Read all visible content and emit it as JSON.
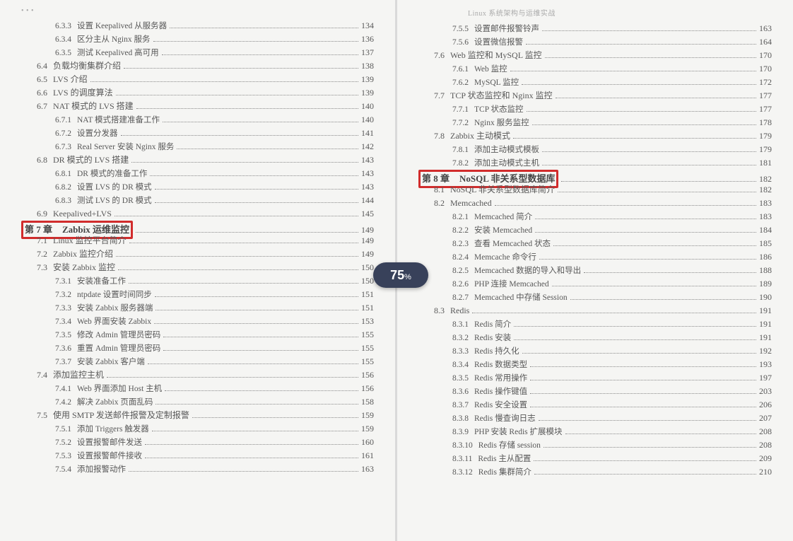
{
  "zoom": {
    "value": "75",
    "suffix": "%"
  },
  "left": {
    "header": "• • •",
    "lines": [
      {
        "lvl": 3,
        "num": "6.3.3",
        "text": "设置 Keepalived 从服务器",
        "page": "134"
      },
      {
        "lvl": 3,
        "num": "6.3.4",
        "text": "区分主从 Nginx 服务",
        "page": "136"
      },
      {
        "lvl": 3,
        "num": "6.3.5",
        "text": "测试 Keepalived 高可用",
        "page": "137"
      },
      {
        "lvl": 2,
        "num": "6.4",
        "text": "负载均衡集群介绍",
        "page": "138"
      },
      {
        "lvl": 2,
        "num": "6.5",
        "text": "LVS 介绍",
        "page": "139"
      },
      {
        "lvl": 2,
        "num": "6.6",
        "text": "LVS 的调度算法",
        "page": "139"
      },
      {
        "lvl": 2,
        "num": "6.7",
        "text": "NAT 模式的 LVS 搭建",
        "page": "140"
      },
      {
        "lvl": 3,
        "num": "6.7.1",
        "text": "NAT 模式搭建准备工作",
        "page": "140"
      },
      {
        "lvl": 3,
        "num": "6.7.2",
        "text": "设置分发器",
        "page": "141"
      },
      {
        "lvl": 3,
        "num": "6.7.3",
        "text": "Real Server 安装 Nginx 服务",
        "page": "142"
      },
      {
        "lvl": 2,
        "num": "6.8",
        "text": "DR 模式的 LVS 搭建",
        "page": "143"
      },
      {
        "lvl": 3,
        "num": "6.8.1",
        "text": "DR 模式的准备工作",
        "page": "143"
      },
      {
        "lvl": 3,
        "num": "6.8.2",
        "text": "设置 LVS 的 DR 模式",
        "page": "143"
      },
      {
        "lvl": 3,
        "num": "6.8.3",
        "text": "测试 LVS 的 DR 模式",
        "page": "144"
      },
      {
        "lvl": 2,
        "num": "6.9",
        "text": "Keepalived+LVS",
        "page": "145"
      },
      {
        "lvl": 1,
        "num": "第 7 章",
        "text": "Zabbix 运维监控",
        "page": "149",
        "hl": true
      },
      {
        "lvl": 2,
        "num": "7.1",
        "text": "Linux 监控平台简介",
        "page": "149"
      },
      {
        "lvl": 2,
        "num": "7.2",
        "text": "Zabbix 监控介绍",
        "page": "149"
      },
      {
        "lvl": 2,
        "num": "7.3",
        "text": "安装 Zabbix 监控",
        "page": "150"
      },
      {
        "lvl": 3,
        "num": "7.3.1",
        "text": "安装准备工作",
        "page": "150"
      },
      {
        "lvl": 3,
        "num": "7.3.2",
        "text": "ntpdate 设置时间同步",
        "page": "151"
      },
      {
        "lvl": 3,
        "num": "7.3.3",
        "text": "安装 Zabbix 服务器端",
        "page": "151"
      },
      {
        "lvl": 3,
        "num": "7.3.4",
        "text": "Web 界面安装 Zabbix",
        "page": "153"
      },
      {
        "lvl": 3,
        "num": "7.3.5",
        "text": "修改 Admin 管理员密码",
        "page": "155"
      },
      {
        "lvl": 3,
        "num": "7.3.6",
        "text": "重置 Admin 管理员密码",
        "page": "155"
      },
      {
        "lvl": 3,
        "num": "7.3.7",
        "text": "安装 Zabbix 客户端",
        "page": "155"
      },
      {
        "lvl": 2,
        "num": "7.4",
        "text": "添加监控主机",
        "page": "156"
      },
      {
        "lvl": 3,
        "num": "7.4.1",
        "text": "Web 界面添加 Host 主机",
        "page": "156"
      },
      {
        "lvl": 3,
        "num": "7.4.2",
        "text": "解决 Zabbix 页面乱码",
        "page": "158"
      },
      {
        "lvl": 2,
        "num": "7.5",
        "text": "使用 SMTP 发送邮件报警及定制报警",
        "page": "159"
      },
      {
        "lvl": 3,
        "num": "7.5.1",
        "text": "添加 Triggers 触发器",
        "page": "159"
      },
      {
        "lvl": 3,
        "num": "7.5.2",
        "text": "设置报警邮件发送",
        "page": "160"
      },
      {
        "lvl": 3,
        "num": "7.5.3",
        "text": "设置报警邮件接收",
        "page": "161"
      },
      {
        "lvl": 3,
        "num": "7.5.4",
        "text": "添加报警动作",
        "page": "163"
      }
    ]
  },
  "right": {
    "header": "Linux 系统架构与运维实战",
    "lines": [
      {
        "lvl": 3,
        "num": "7.5.5",
        "text": "设置邮件报警铃声",
        "page": "163"
      },
      {
        "lvl": 3,
        "num": "7.5.6",
        "text": "设置微信报警",
        "page": "164"
      },
      {
        "lvl": 2,
        "num": "7.6",
        "text": "Web 监控和 MySQL 监控",
        "page": "170"
      },
      {
        "lvl": 3,
        "num": "7.6.1",
        "text": "Web 监控",
        "page": "170"
      },
      {
        "lvl": 3,
        "num": "7.6.2",
        "text": "MySQL 监控",
        "page": "172"
      },
      {
        "lvl": 2,
        "num": "7.7",
        "text": "TCP 状态监控和 Nginx 监控",
        "page": "177"
      },
      {
        "lvl": 3,
        "num": "7.7.1",
        "text": "TCP 状态监控",
        "page": "177"
      },
      {
        "lvl": 3,
        "num": "7.7.2",
        "text": "Nginx 服务监控",
        "page": "178"
      },
      {
        "lvl": 2,
        "num": "7.8",
        "text": "Zabbix 主动模式",
        "page": "179"
      },
      {
        "lvl": 3,
        "num": "7.8.1",
        "text": "添加主动模式模板",
        "page": "179"
      },
      {
        "lvl": 3,
        "num": "7.8.2",
        "text": "添加主动模式主机",
        "page": "181"
      },
      {
        "lvl": 1,
        "num": "第 8 章",
        "text": "NoSQL 非关系型数据库",
        "page": "182",
        "hl": true
      },
      {
        "lvl": 2,
        "num": "8.1",
        "text": "NoSQL 非关系型数据库简介",
        "page": "182"
      },
      {
        "lvl": 2,
        "num": "8.2",
        "text": "Memcached",
        "page": "183"
      },
      {
        "lvl": 3,
        "num": "8.2.1",
        "text": "Memcached 简介",
        "page": "183"
      },
      {
        "lvl": 3,
        "num": "8.2.2",
        "text": "安装 Memcached",
        "page": "184"
      },
      {
        "lvl": 3,
        "num": "8.2.3",
        "text": "查看 Memcached 状态",
        "page": "185"
      },
      {
        "lvl": 3,
        "num": "8.2.4",
        "text": "Memcache 命令行",
        "page": "186"
      },
      {
        "lvl": 3,
        "num": "8.2.5",
        "text": "Memcached 数据的导入和导出",
        "page": "188"
      },
      {
        "lvl": 3,
        "num": "8.2.6",
        "text": "PHP 连接 Memcached",
        "page": "189"
      },
      {
        "lvl": 3,
        "num": "8.2.7",
        "text": "Memcached 中存储 Session",
        "page": "190"
      },
      {
        "lvl": 2,
        "num": "8.3",
        "text": "Redis",
        "page": "191"
      },
      {
        "lvl": 3,
        "num": "8.3.1",
        "text": "Redis 简介",
        "page": "191"
      },
      {
        "lvl": 3,
        "num": "8.3.2",
        "text": "Redis 安装",
        "page": "191"
      },
      {
        "lvl": 3,
        "num": "8.3.3",
        "text": "Redis 持久化",
        "page": "192"
      },
      {
        "lvl": 3,
        "num": "8.3.4",
        "text": "Redis 数据类型",
        "page": "193"
      },
      {
        "lvl": 3,
        "num": "8.3.5",
        "text": "Redis 常用操作",
        "page": "197"
      },
      {
        "lvl": 3,
        "num": "8.3.6",
        "text": "Redis 操作键值",
        "page": "203"
      },
      {
        "lvl": 3,
        "num": "8.3.7",
        "text": "Redis 安全设置",
        "page": "206"
      },
      {
        "lvl": 3,
        "num": "8.3.8",
        "text": "Redis 慢查询日志",
        "page": "207"
      },
      {
        "lvl": 3,
        "num": "8.3.9",
        "text": "PHP 安装 Redis 扩展模块",
        "page": "208"
      },
      {
        "lvl": 3,
        "num": "8.3.10",
        "text": "Redis 存储 session",
        "page": "208"
      },
      {
        "lvl": 3,
        "num": "8.3.11",
        "text": "Redis 主从配置",
        "page": "209"
      },
      {
        "lvl": 3,
        "num": "8.3.12",
        "text": "Redis 集群简介",
        "page": "210"
      }
    ]
  }
}
